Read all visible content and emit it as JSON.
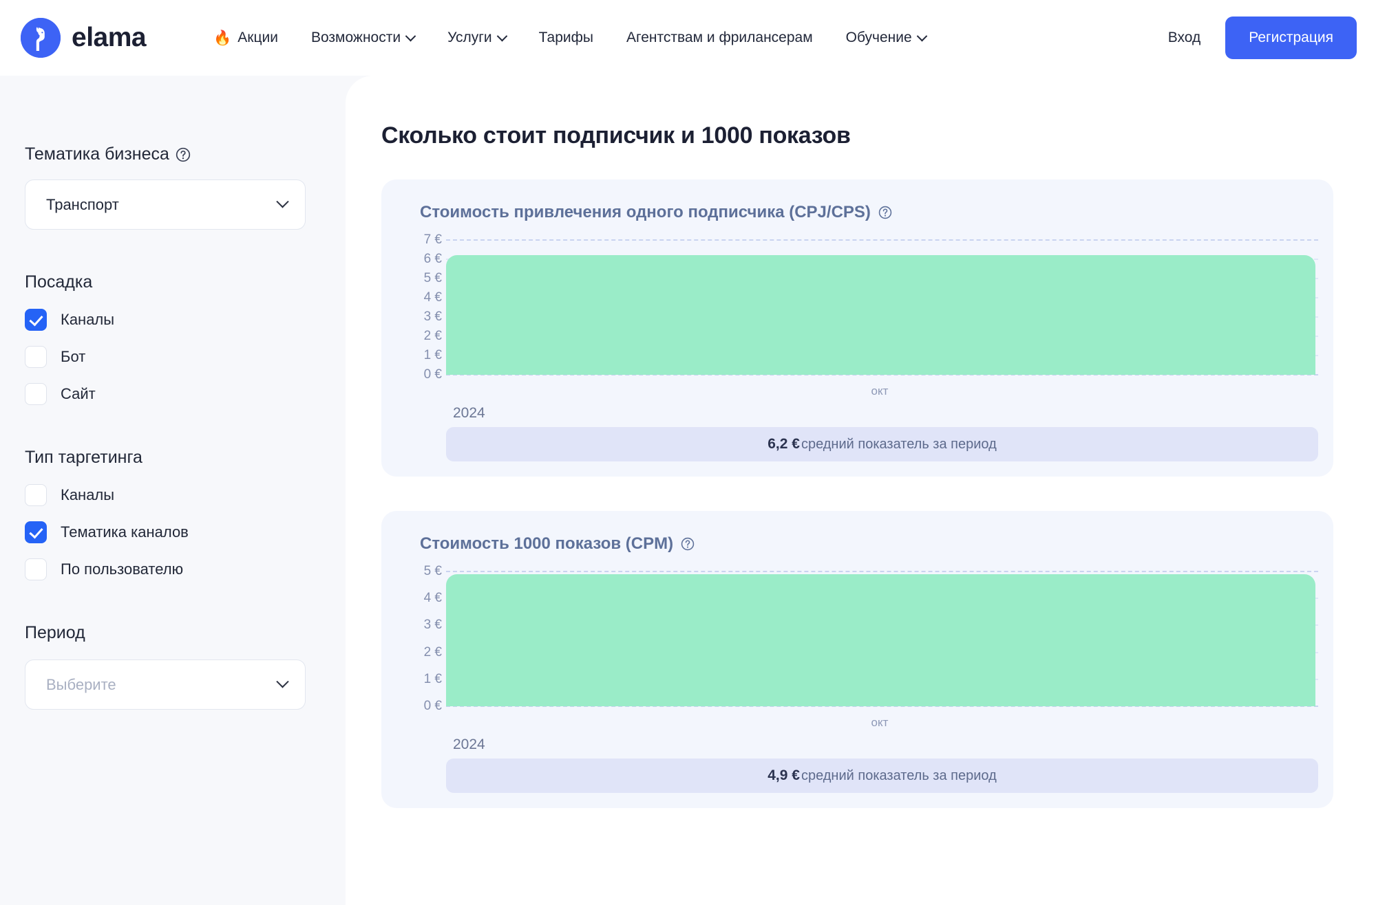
{
  "brand": {
    "name": "elama",
    "logo_icon": "llama-logo-icon",
    "accent_color": "#3d63f5"
  },
  "header": {
    "nav": [
      {
        "label": "Акции",
        "icon": "fire-icon",
        "has_caret": false
      },
      {
        "label": "Возможности",
        "icon": null,
        "has_caret": true
      },
      {
        "label": "Услуги",
        "icon": null,
        "has_caret": true
      },
      {
        "label": "Тарифы",
        "icon": null,
        "has_caret": false
      },
      {
        "label": "Агентствам и фрилансерам",
        "icon": null,
        "has_caret": false
      },
      {
        "label": "Обучение",
        "icon": null,
        "has_caret": true
      }
    ],
    "login_label": "Вход",
    "signup_label": "Регистрация"
  },
  "sidebar": {
    "business_topic": {
      "label": "Тематика бизнеса",
      "help_icon": "question-circle-icon",
      "value": "Транспорт",
      "chevron_icon": "chevron-down-icon"
    },
    "landing": {
      "title": "Посадка",
      "options": [
        {
          "label": "Каналы",
          "checked": true
        },
        {
          "label": "Бот",
          "checked": false
        },
        {
          "label": "Сайт",
          "checked": false
        }
      ]
    },
    "targeting": {
      "title": "Тип таргетинга",
      "options": [
        {
          "label": "Каналы",
          "checked": false
        },
        {
          "label": "Тематика каналов",
          "checked": true
        },
        {
          "label": "По пользователю",
          "checked": false
        }
      ]
    },
    "period": {
      "title": "Период",
      "placeholder": "Выберите",
      "value": "",
      "chevron_icon": "chevron-down-icon"
    }
  },
  "main": {
    "page_title": "Сколько стоит подписчик и 1000 показов"
  },
  "chart_data": [
    {
      "type": "area",
      "title": "Стоимость привлечения одного подписчика (CPJ/CPS)",
      "help_icon": "question-circle-icon",
      "x": [
        "окт"
      ],
      "categories": [
        "окт"
      ],
      "values": [
        6.2
      ],
      "series": [
        {
          "name": "CPJ/CPS",
          "values": [
            6.2
          ]
        }
      ],
      "year_label": "2024",
      "xlabel": "",
      "ylabel": "",
      "ylim": [
        0,
        7
      ],
      "yticks": [
        7,
        6,
        5,
        4,
        3,
        2,
        1,
        0
      ],
      "ytick_labels": [
        "7 €",
        "6 €",
        "5 €",
        "4 €",
        "3 €",
        "2 €",
        "1 €",
        "0 €"
      ],
      "grid": true,
      "legend": "none",
      "fill_color": "#9aecc8",
      "average_value": "6,2 €",
      "average_label": "средний показатель за период"
    },
    {
      "type": "area",
      "title": "Стоимость 1000 показов (CPM)",
      "help_icon": "question-circle-icon",
      "x": [
        "окт"
      ],
      "categories": [
        "окт"
      ],
      "values": [
        4.9
      ],
      "series": [
        {
          "name": "CPM",
          "values": [
            4.9
          ]
        }
      ],
      "year_label": "2024",
      "xlabel": "",
      "ylabel": "",
      "ylim": [
        0,
        5
      ],
      "yticks": [
        5,
        4,
        3,
        2,
        1,
        0
      ],
      "ytick_labels": [
        "5 €",
        "4 €",
        "3 €",
        "2 €",
        "1 €",
        "0 €"
      ],
      "grid": true,
      "legend": "none",
      "fill_color": "#9aecc8",
      "average_value": "4,9 €",
      "average_label": "средний показатель за период"
    }
  ]
}
